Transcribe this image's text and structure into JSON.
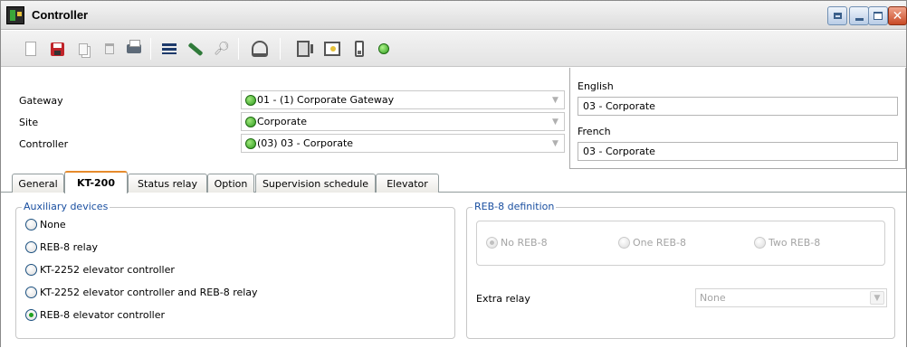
{
  "window": {
    "title": "Controller",
    "controls": [
      "restore",
      "minimize",
      "maximize",
      "close"
    ]
  },
  "toolbar": {
    "buttons": [
      {
        "name": "new",
        "icon": "new-document-icon",
        "enabled": false
      },
      {
        "name": "save",
        "icon": "save-icon",
        "enabled": true
      },
      {
        "name": "copy",
        "icon": "copy-icon",
        "enabled": false
      },
      {
        "name": "delete",
        "icon": "trash-icon",
        "enabled": false
      },
      {
        "name": "print",
        "icon": "printer-icon",
        "enabled": true
      },
      {
        "name": "list",
        "icon": "list-icon",
        "enabled": true
      },
      {
        "name": "edit",
        "icon": "pencil-icon",
        "enabled": true
      },
      {
        "name": "find",
        "icon": "binoculars-icon",
        "enabled": false
      },
      {
        "name": "users",
        "icon": "user-icon",
        "enabled": true
      },
      {
        "name": "doors",
        "icon": "door-icon",
        "enabled": true
      },
      {
        "name": "access",
        "icon": "key-card-icon",
        "enabled": true
      },
      {
        "name": "relay",
        "icon": "relay-icon",
        "enabled": true
      },
      {
        "name": "status",
        "icon": "status-green-icon",
        "enabled": true
      }
    ]
  },
  "header": {
    "gateway": {
      "label": "Gateway",
      "value": "01 - (1)  Corporate Gateway",
      "status_color": "#2e9a1e"
    },
    "site": {
      "label": "Site",
      "value": "Corporate",
      "status_color": "#2e9a1e"
    },
    "controller": {
      "label": "Controller",
      "value": "(03) 03 - Corporate",
      "status_color": "#2e9a1e"
    }
  },
  "languages": {
    "english": {
      "label": "English",
      "value": "03 - Corporate"
    },
    "french": {
      "label": "French",
      "value": "03 - Corporate"
    }
  },
  "tabs": [
    {
      "label": "General",
      "active": false
    },
    {
      "label": "KT-200",
      "active": true
    },
    {
      "label": "Status relay",
      "active": false
    },
    {
      "label": "Option",
      "active": false
    },
    {
      "label": "Supervision schedule",
      "active": false
    },
    {
      "label": "Elevator",
      "active": false
    }
  ],
  "auxiliary": {
    "legend": "Auxiliary devices",
    "options": [
      {
        "label": "None",
        "checked": false
      },
      {
        "label": "REB-8 relay",
        "checked": false
      },
      {
        "label": "KT-2252 elevator controller",
        "checked": false
      },
      {
        "label": "KT-2252 elevator controller and REB-8 relay",
        "checked": false
      },
      {
        "label": "REB-8 elevator controller",
        "checked": true
      }
    ]
  },
  "reb8": {
    "legend": "REB-8 definition",
    "options": [
      {
        "label": "No REB-8",
        "checked": true
      },
      {
        "label": "One REB-8",
        "checked": false
      },
      {
        "label": "Two REB-8",
        "checked": false
      }
    ],
    "extra_relay": {
      "label": "Extra relay",
      "value": "None"
    }
  },
  "colors": {
    "accent_tab": "#e68b2c",
    "legend_text": "#1a4fa0",
    "status_green": "#2e9a1e"
  }
}
